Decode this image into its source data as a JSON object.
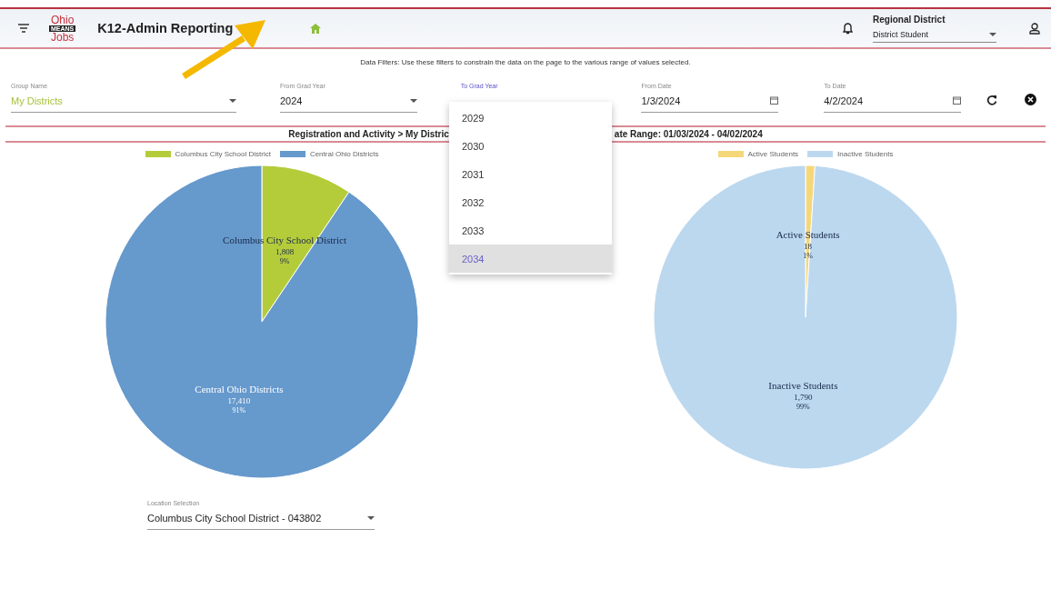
{
  "header": {
    "logo": {
      "top": "Ohio",
      "middle": "MEANS",
      "bottom": "Jobs"
    },
    "title": "K12-Admin Reporting",
    "role_select": {
      "label": "Regional District",
      "value": "District Student"
    }
  },
  "filters_note": "Data Filters: Use these filters to constrain the data on the page to the various range of values selected.",
  "filters": [
    {
      "kind": "select",
      "label": "Group Name",
      "value": "My Districts",
      "focused": false
    },
    {
      "kind": "select",
      "label": "From Grad Year",
      "value": "2024",
      "focused": false
    },
    {
      "kind": "select",
      "label": "To Grad Year",
      "focused": true
    },
    {
      "kind": "date",
      "label": "From Date",
      "value": "1/3/2024",
      "focused": false
    },
    {
      "kind": "date",
      "label": "To Date",
      "value": "4/2/2024",
      "focused": false
    }
  ],
  "dropdown": {
    "options": [
      {
        "label": "2029",
        "selected": false
      },
      {
        "label": "2030",
        "selected": false
      },
      {
        "label": "2031",
        "selected": false
      },
      {
        "label": "2032",
        "selected": false
      },
      {
        "label": "2033",
        "selected": false
      },
      {
        "label": "2034",
        "selected": true
      }
    ]
  },
  "breadcrumb": {
    "left": "Registration and Activity > My Distric",
    "right": "ate Range: 01/03/2024 - 04/02/2024"
  },
  "charts": [
    {
      "chart_data": {
        "type": "pie",
        "categories": [
          "Columbus City School District",
          "Central Ohio Districts"
        ],
        "values": [
          1808,
          17410
        ],
        "colors": [
          "#b5cc3a",
          "#6699cc"
        ],
        "value_labels": [
          "1,808",
          "17,410"
        ],
        "annotations": [
          "9%",
          "91%"
        ]
      }
    },
    {
      "chart_data": {
        "type": "pie",
        "categories": [
          "Active Students",
          "Inactive Students"
        ],
        "values": [
          18,
          1790
        ],
        "colors": [
          "#f5d77a",
          "#bcd8ef"
        ],
        "value_labels": [
          "18",
          "1,790"
        ],
        "annotations": [
          "1%",
          "99%"
        ]
      }
    }
  ],
  "location_select": {
    "label": "Location Selection",
    "value": "Columbus City School District - 043802"
  }
}
